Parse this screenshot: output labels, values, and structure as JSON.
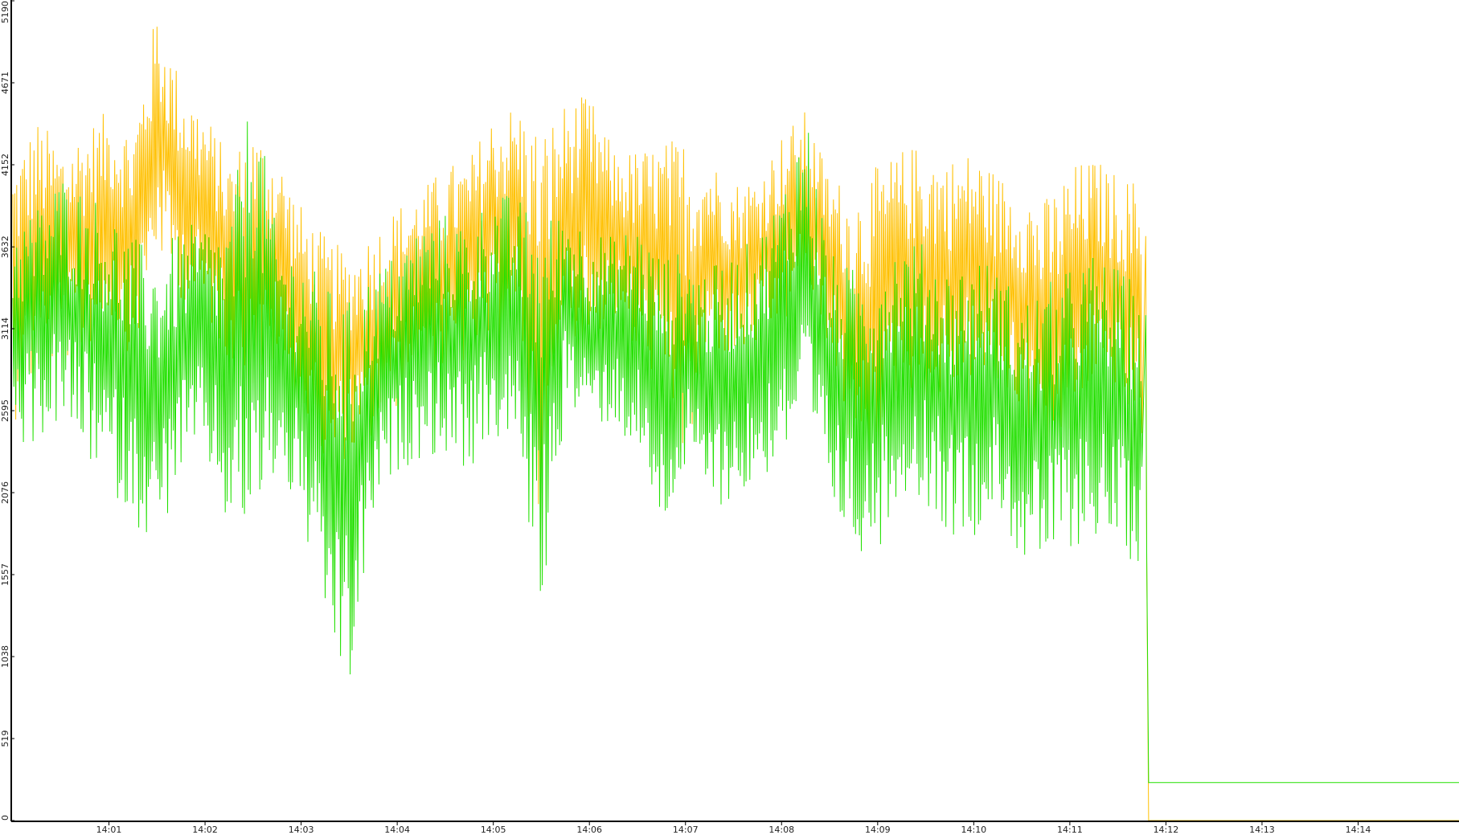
{
  "chart_data": {
    "type": "line",
    "title": "",
    "xlabel": "",
    "ylabel": "",
    "x_tick_labels": [
      "14:01",
      "14:02",
      "14:03",
      "14:04",
      "14:05",
      "14:06",
      "14:07",
      "14:08",
      "14:09",
      "14:10",
      "14:11",
      "14:12",
      "14:13",
      "14:14"
    ],
    "y_tick_values": [
      0,
      519,
      1038,
      1557,
      2076,
      2595,
      3114,
      3632,
      4152,
      4671,
      5190
    ],
    "ylim": [
      0,
      5190
    ],
    "xlim_minutes": [
      0,
      15.05
    ],
    "x_start_time": "14:00",
    "grid": false,
    "legend": "none",
    "colors": {
      "axis": "#000000",
      "background": "#ffffff",
      "series_orange": "#ffc000",
      "series_green": "#22e000"
    },
    "series": [
      {
        "color": "#ffc000",
        "t_minutes": [
          0.0,
          0.25,
          0.5,
          0.75,
          1.0,
          1.25,
          1.5,
          1.75,
          2.0,
          2.25,
          2.5,
          2.75,
          3.0,
          3.25,
          3.5,
          3.75,
          4.0,
          4.25,
          4.5,
          4.75,
          5.0,
          5.25,
          5.5,
          5.75,
          6.0,
          6.25,
          6.5,
          6.75,
          7.0,
          7.25,
          7.5,
          7.75,
          8.0,
          8.25,
          8.5,
          8.75,
          9.0,
          9.25,
          9.5,
          9.75,
          10.0,
          10.25,
          10.5,
          10.75,
          11.0,
          11.25,
          11.5,
          11.75,
          11.79,
          11.8,
          11.82,
          15.05
        ],
        "high": [
          4200,
          4450,
          4300,
          4400,
          4500,
          4400,
          5150,
          4700,
          4500,
          4200,
          4400,
          4250,
          3900,
          3700,
          3600,
          3750,
          3900,
          4000,
          4150,
          4200,
          4500,
          4550,
          4400,
          4550,
          4600,
          4250,
          4250,
          4300,
          4350,
          4200,
          4050,
          4100,
          4350,
          4500,
          4100,
          4000,
          4150,
          4250,
          4300,
          4200,
          4250,
          4100,
          4050,
          3950,
          4150,
          4200,
          4100,
          4050,
          3700,
          1650,
          0,
          0
        ],
        "low": [
          2500,
          2800,
          2900,
          2950,
          3200,
          2900,
          3600,
          3300,
          3200,
          2900,
          2700,
          2900,
          2500,
          2200,
          2300,
          2400,
          2600,
          2900,
          2800,
          2900,
          3000,
          3050,
          1700,
          3100,
          3000,
          3200,
          2900,
          2800,
          2100,
          3000,
          2900,
          3000,
          3100,
          3300,
          3000,
          2200,
          2300,
          2800,
          2600,
          2700,
          2800,
          2700,
          2600,
          2100,
          2400,
          2800,
          2600,
          2400,
          1800,
          0,
          0,
          0
        ]
      },
      {
        "color": "#22e000",
        "t_minutes": [
          0.0,
          0.25,
          0.5,
          0.75,
          1.0,
          1.25,
          1.5,
          1.75,
          2.0,
          2.25,
          2.5,
          2.75,
          3.0,
          3.25,
          3.5,
          3.75,
          4.0,
          4.25,
          4.5,
          4.75,
          5.0,
          5.25,
          5.5,
          5.75,
          6.0,
          6.25,
          6.5,
          6.75,
          7.0,
          7.25,
          7.5,
          7.75,
          8.0,
          8.25,
          8.5,
          8.75,
          9.0,
          9.25,
          9.5,
          9.75,
          10.0,
          10.25,
          10.5,
          10.75,
          11.0,
          11.25,
          11.5,
          11.75,
          11.79,
          11.8,
          11.82,
          15.05
        ],
        "high": [
          3800,
          3900,
          4100,
          4000,
          3900,
          3700,
          3600,
          3750,
          3800,
          3800,
          4700,
          3700,
          3600,
          3400,
          3300,
          3500,
          3600,
          3800,
          3850,
          3800,
          4000,
          3950,
          3800,
          3900,
          3750,
          3700,
          3800,
          3600,
          3600,
          3500,
          3600,
          3700,
          4000,
          4550,
          3600,
          3500,
          3600,
          3700,
          3650,
          3500,
          3600,
          3500,
          3300,
          3400,
          3500,
          3600,
          3500,
          3400,
          3200,
          1700,
          240,
          240
        ],
        "low": [
          2300,
          2400,
          2500,
          2300,
          2100,
          1900,
          1700,
          2200,
          2300,
          1800,
          1800,
          2200,
          1900,
          1200,
          750,
          1900,
          2200,
          2300,
          2300,
          2200,
          2400,
          2350,
          1300,
          2600,
          2500,
          2500,
          2300,
          1800,
          2200,
          2000,
          2000,
          2100,
          2300,
          2400,
          2000,
          1700,
          1700,
          2100,
          2000,
          1800,
          1800,
          2000,
          1600,
          1600,
          1700,
          1800,
          1700,
          1600,
          1500,
          0,
          0,
          0
        ]
      }
    ]
  }
}
